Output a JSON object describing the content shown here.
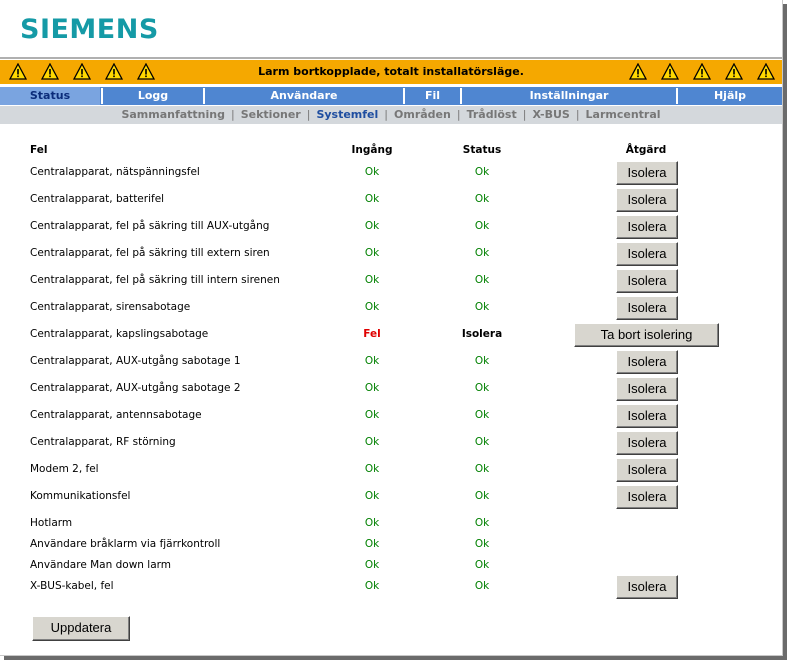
{
  "brand": {
    "logo_text": "SIEMENS"
  },
  "alarm_bar": {
    "message": "Larm bortkopplade, totalt installatörsläge.",
    "icon": "warning-triangle-icon",
    "color": "#f5a800"
  },
  "nav": {
    "items": [
      {
        "label": "Status",
        "active": true
      },
      {
        "label": "Logg",
        "active": false
      },
      {
        "label": "Användare",
        "active": false
      },
      {
        "label": "Fil",
        "active": false
      },
      {
        "label": "Inställningar",
        "active": false
      },
      {
        "label": "Hjälp",
        "active": false
      }
    ]
  },
  "subnav": {
    "items": [
      {
        "label": "Sammanfattning",
        "active": false
      },
      {
        "label": "Sektioner",
        "active": false
      },
      {
        "label": "Systemfel",
        "active": true
      },
      {
        "label": "Områden",
        "active": false
      },
      {
        "label": "Trådlöst",
        "active": false
      },
      {
        "label": "X-BUS",
        "active": false
      },
      {
        "label": "Larmcentral",
        "active": false
      }
    ],
    "separator": "|"
  },
  "table": {
    "headers": {
      "fault": "Fel",
      "input": "Ingång",
      "status": "Status",
      "action": "Åtgärd"
    },
    "rows": [
      {
        "name": "Centralapparat, nätspänningsfel",
        "input": "Ok",
        "status": "Ok",
        "action": "Isolera"
      },
      {
        "name": "Centralapparat, batterifel",
        "input": "Ok",
        "status": "Ok",
        "action": "Isolera"
      },
      {
        "name": "Centralapparat, fel på säkring till AUX-utgång",
        "input": "Ok",
        "status": "Ok",
        "action": "Isolera"
      },
      {
        "name": "Centralapparat, fel på säkring till extern siren",
        "input": "Ok",
        "status": "Ok",
        "action": "Isolera"
      },
      {
        "name": "Centralapparat, fel på säkring till intern sirenen",
        "input": "Ok",
        "status": "Ok",
        "action": "Isolera"
      },
      {
        "name": "Centralapparat, sirensabotage",
        "input": "Ok",
        "status": "Ok",
        "action": "Isolera"
      },
      {
        "name": "Centralapparat, kapslingsabotage",
        "input": "Fel",
        "status": "Isolera",
        "action": "Ta bort isolering"
      },
      {
        "name": "Centralapparat, AUX-utgång sabotage 1",
        "input": "Ok",
        "status": "Ok",
        "action": "Isolera"
      },
      {
        "name": "Centralapparat, AUX-utgång sabotage 2",
        "input": "Ok",
        "status": "Ok",
        "action": "Isolera"
      },
      {
        "name": "Centralapparat, antennsabotage",
        "input": "Ok",
        "status": "Ok",
        "action": "Isolera"
      },
      {
        "name": "Centralapparat, RF störning",
        "input": "Ok",
        "status": "Ok",
        "action": "Isolera"
      },
      {
        "name": "Modem 2, fel",
        "input": "Ok",
        "status": "Ok",
        "action": "Isolera"
      },
      {
        "name": "Kommunikationsfel",
        "input": "Ok",
        "status": "Ok",
        "action": "Isolera"
      },
      {
        "name": "Hotlarm",
        "input": "Ok",
        "status": "Ok",
        "action": ""
      },
      {
        "name": "Användare bråklarm via fjärrkontroll",
        "input": "Ok",
        "status": "Ok",
        "action": ""
      },
      {
        "name": "Användare Man down larm",
        "input": "Ok",
        "status": "Ok",
        "action": ""
      },
      {
        "name": "X-BUS-kabel, fel",
        "input": "Ok",
        "status": "Ok",
        "action": "Isolera"
      }
    ]
  },
  "footer": {
    "update_label": "Uppdatera"
  },
  "colors": {
    "accent": "#159aa6",
    "nav": "#4f86d1",
    "ok": "#008000",
    "fault": "#e00000"
  }
}
